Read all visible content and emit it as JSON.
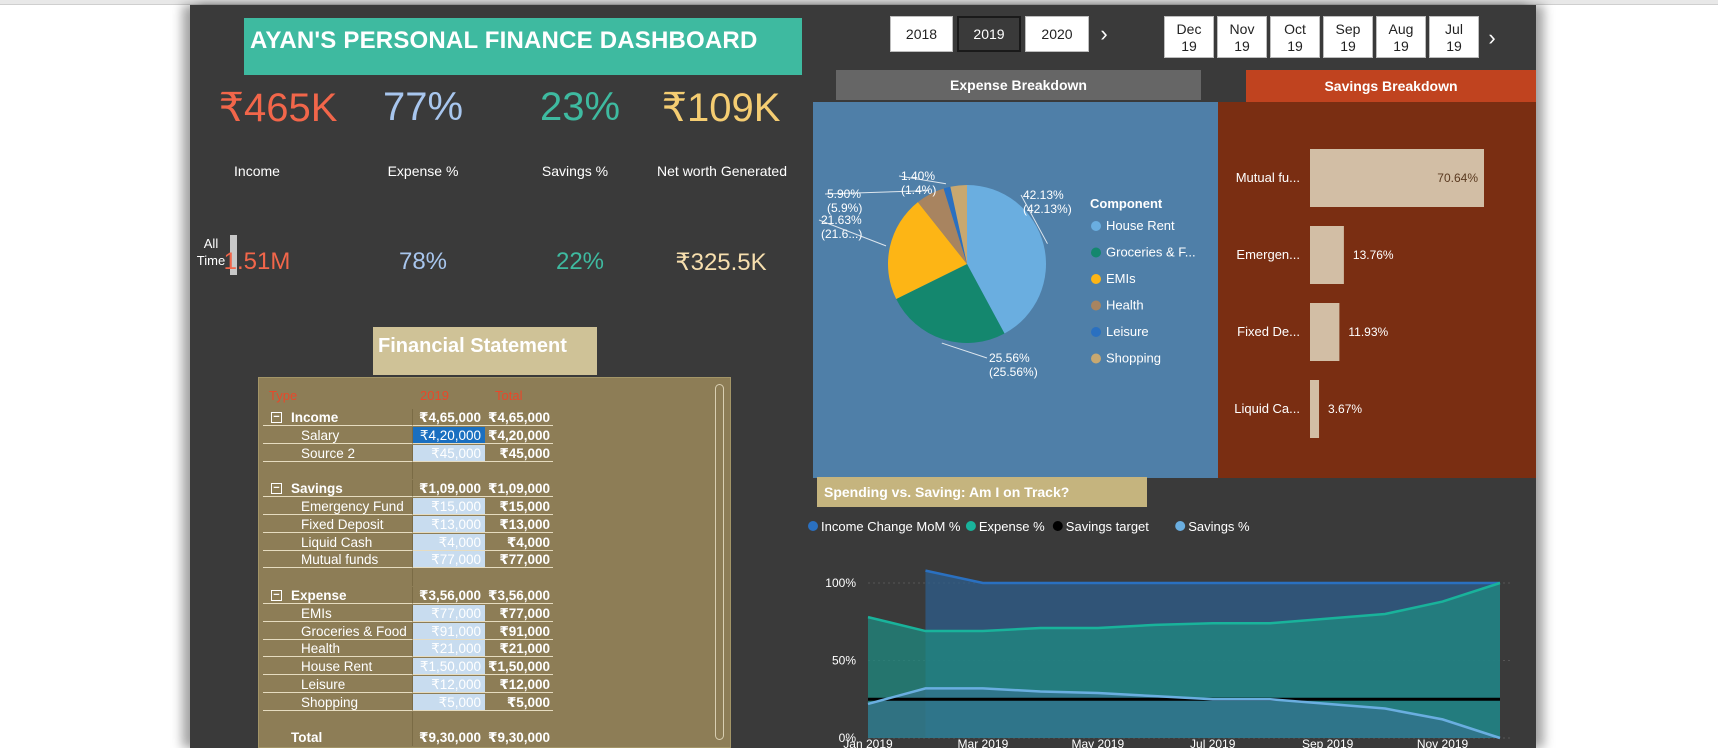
{
  "dashboard": {
    "title": "AYAN'S PERSONAL FINANCE DASHBOARD"
  },
  "colors": {
    "canvas_bg": "#3a3a3a",
    "title_bg": "#3ebaa0",
    "income": "#f2664a",
    "expense_pct": "#a8c6ee",
    "savings_pct": "#3ebaa0",
    "networth": "#f5cd72",
    "statement_bg": "#8d7d56",
    "expense_panel_bg": "#4f7fa8",
    "savings_panel_bg": "#7a2e12"
  },
  "kpis": [
    {
      "value": "₹465K",
      "label": "Income",
      "alltime": "1.51M"
    },
    {
      "value": "77%",
      "label": "Expense %",
      "alltime": "78%"
    },
    {
      "value": "23%",
      "label": "Savings %",
      "alltime": "22%"
    },
    {
      "value": "₹109K",
      "label": "Net worth Generated",
      "alltime": "₹325.5K"
    }
  ],
  "alltime_label": "All Time",
  "year_slicer": {
    "years": [
      "2018",
      "2019",
      "2020"
    ],
    "selected": "2019",
    "next_icon": "chevron-right-icon"
  },
  "month_slicer": {
    "months": [
      {
        "mon": "Dec",
        "yr": "19"
      },
      {
        "mon": "Nov",
        "yr": "19"
      },
      {
        "mon": "Oct",
        "yr": "19"
      },
      {
        "mon": "Sep",
        "yr": "19"
      },
      {
        "mon": "Aug",
        "yr": "19"
      },
      {
        "mon": "Jul",
        "yr": "19"
      }
    ],
    "next_icon": "chevron-right-icon"
  },
  "statement": {
    "title": "Financial Statement",
    "headers": {
      "type": "Type",
      "year": "2019",
      "total": "Total"
    },
    "rows": [
      {
        "kind": "grp",
        "label": "Income",
        "v1": "₹4,65,000",
        "v2": "₹4,65,000"
      },
      {
        "kind": "child sel",
        "label": "Salary",
        "v1": "₹4,20,000",
        "v2": "₹4,20,000"
      },
      {
        "kind": "child",
        "label": "Source 2",
        "v1": "₹45,000",
        "v2": "₹45,000"
      },
      {
        "kind": "blank",
        "label": "",
        "v1": "",
        "v2": ""
      },
      {
        "kind": "grp",
        "label": "Savings",
        "v1": "₹1,09,000",
        "v2": "₹1,09,000"
      },
      {
        "kind": "child",
        "label": "Emergency Fund",
        "v1": "₹15,000",
        "v2": "₹15,000"
      },
      {
        "kind": "child",
        "label": "Fixed Deposit",
        "v1": "₹13,000",
        "v2": "₹13,000"
      },
      {
        "kind": "child",
        "label": "Liquid Cash",
        "v1": "₹4,000",
        "v2": "₹4,000"
      },
      {
        "kind": "child",
        "label": "Mutual funds",
        "v1": "₹77,000",
        "v2": "₹77,000"
      },
      {
        "kind": "blank",
        "label": "",
        "v1": "",
        "v2": ""
      },
      {
        "kind": "grp",
        "label": "Expense",
        "v1": "₹3,56,000",
        "v2": "₹3,56,000"
      },
      {
        "kind": "child",
        "label": "EMIs",
        "v1": "₹77,000",
        "v2": "₹77,000"
      },
      {
        "kind": "child",
        "label": "Groceries & Food",
        "v1": "₹91,000",
        "v2": "₹91,000"
      },
      {
        "kind": "child",
        "label": "Health",
        "v1": "₹21,000",
        "v2": "₹21,000"
      },
      {
        "kind": "child",
        "label": "House Rent",
        "v1": "₹1,50,000",
        "v2": "₹1,50,000"
      },
      {
        "kind": "child",
        "label": "Leisure",
        "v1": "₹12,000",
        "v2": "₹12,000"
      },
      {
        "kind": "child",
        "label": "Shopping",
        "v1": "₹5,000",
        "v2": "₹5,000"
      },
      {
        "kind": "blank",
        "label": "",
        "v1": "",
        "v2": ""
      },
      {
        "kind": "total",
        "label": "Total",
        "v1": "₹9,30,000",
        "v2": "₹9,30,000"
      }
    ]
  },
  "expense_breakdown": {
    "title": "Expense Breakdown",
    "legend_title": "Component"
  },
  "savings_breakdown": {
    "title": "Savings Breakdown"
  },
  "spending": {
    "title": "Spending vs. Saving: Am I on Track?"
  },
  "chart_data": [
    {
      "type": "pie",
      "title": "Expense Breakdown",
      "legend_title": "Component",
      "slices": [
        {
          "name": "House Rent",
          "value": 42.13,
          "label": "42.13% (42.13%)",
          "color": "#6aaee0"
        },
        {
          "name": "Groceries & F...",
          "value": 25.56,
          "label": "25.56% (25.56%)",
          "color": "#14876e"
        },
        {
          "name": "EMIs",
          "value": 21.63,
          "label": "21.63% (21.6...)",
          "color": "#fdb515"
        },
        {
          "name": "Health",
          "value": 5.9,
          "label": "5.90% (5.9%)",
          "color": "#a88460"
        },
        {
          "name": "Leisure",
          "value": 1.4,
          "label": "1.40% (1.4%)",
          "color": "#2a70c0"
        },
        {
          "name": "Shopping",
          "value": 3.38,
          "label": "",
          "color": "#c8a870"
        }
      ]
    },
    {
      "type": "bar",
      "orientation": "horizontal",
      "title": "Savings Breakdown",
      "categories": [
        "Mutual fu...",
        "Emergen...",
        "Fixed De...",
        "Liquid Ca..."
      ],
      "values": [
        70.64,
        13.76,
        11.93,
        3.67
      ],
      "labels": [
        "70.64%",
        "13.76%",
        "11.93%",
        "3.67%"
      ],
      "color": "#d2bea5"
    },
    {
      "type": "area",
      "title": "Spending vs. Saving: Am I on Track?",
      "x": [
        "Jan 2019",
        "Feb 2019",
        "Mar 2019",
        "Apr 2019",
        "May 2019",
        "Jun 2019",
        "Jul 2019",
        "Aug 2019",
        "Sep 2019",
        "Oct 2019",
        "Nov 2019",
        "Dec 2019"
      ],
      "x_ticks": [
        "Jan 2019",
        "Mar 2019",
        "May 2019",
        "Jul 2019",
        "Sep 2019",
        "Nov 2019"
      ],
      "y_ticks": [
        "0%",
        "50%",
        "100%"
      ],
      "ylim": [
        0,
        100
      ],
      "series": [
        {
          "name": "Income Change MoM %",
          "color": "#2a70c0",
          "values": [
            null,
            108,
            100,
            100,
            100,
            100,
            100,
            100,
            100,
            100,
            100,
            100
          ]
        },
        {
          "name": "Expense %",
          "color": "#19b39b",
          "values": [
            78,
            69,
            69,
            71,
            71,
            73,
            74,
            74,
            77,
            80,
            88,
            100
          ]
        },
        {
          "name": "Savings target",
          "color": "#000000",
          "values": [
            25,
            25,
            25,
            25,
            25,
            25,
            25,
            25,
            25,
            25,
            25,
            25
          ]
        },
        {
          "name": "Savings %",
          "color": "#6aaee0",
          "values": [
            22,
            32,
            32,
            30,
            29,
            27,
            25,
            25,
            22,
            19,
            12,
            0
          ]
        }
      ]
    }
  ]
}
